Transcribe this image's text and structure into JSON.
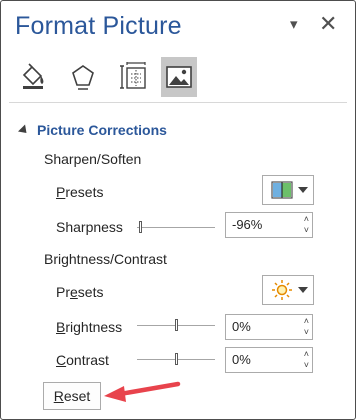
{
  "pane": {
    "title": "Format Picture",
    "dropdown_icon": "chevron-down-icon",
    "close_icon": "close-icon"
  },
  "categories": [
    {
      "id": "fill-line",
      "icon": "paint-bucket-icon",
      "selected": false
    },
    {
      "id": "effects",
      "icon": "pentagon-icon",
      "selected": false
    },
    {
      "id": "size-properties",
      "icon": "size-properties-icon",
      "selected": false
    },
    {
      "id": "picture",
      "icon": "picture-icon",
      "selected": true
    }
  ],
  "section": {
    "title": "Picture Corrections",
    "sharpen": {
      "heading": "Sharpen/Soften",
      "presets_label_prefix": "",
      "presets_label_mnemonic": "P",
      "presets_label_rest": "resets",
      "sharpness_label": "Sharpness",
      "sharpness_value": "-96%",
      "sharpness_level": -96
    },
    "brightness_contrast": {
      "heading": "Brightness/Contrast",
      "presets_label_prefix": "Pr",
      "presets_label_mnemonic": "e",
      "presets_label_rest": "sets",
      "brightness_label_mnemonic": "B",
      "brightness_label_rest": "rightness",
      "brightness_value": "0%",
      "brightness_level": 0,
      "contrast_label_mnemonic": "C",
      "contrast_label_rest": "ontrast",
      "contrast_value": "0%",
      "contrast_level": 0
    },
    "reset_mnemonic": "R",
    "reset_rest": "eset"
  },
  "colors": {
    "accent": "#2b579a",
    "annotation_arrow": "#e8434c"
  }
}
